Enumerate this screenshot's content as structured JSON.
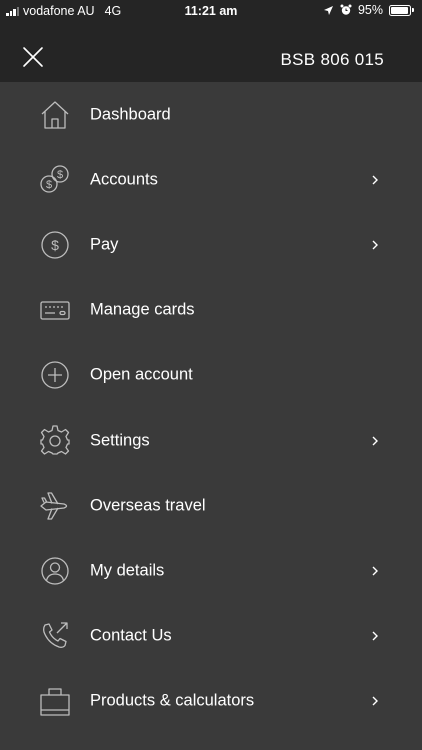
{
  "status_bar": {
    "carrier": "vodafone AU",
    "network": "4G",
    "time": "11:21 am",
    "battery": "95%",
    "battery_level": 0.95
  },
  "header": {
    "bsb": "BSB 806 015"
  },
  "menu": {
    "items": [
      {
        "label": "Dashboard",
        "icon": "home-icon",
        "has_chevron": false
      },
      {
        "label": "Accounts",
        "icon": "coins-icon",
        "has_chevron": true
      },
      {
        "label": "Pay",
        "icon": "dollar-circle-icon",
        "has_chevron": true
      },
      {
        "label": "Manage cards",
        "icon": "card-icon",
        "has_chevron": false
      },
      {
        "label": "Open account",
        "icon": "plus-circle-icon",
        "has_chevron": false
      },
      {
        "label": "Settings",
        "icon": "gear-icon",
        "has_chevron": true
      },
      {
        "label": "Overseas travel",
        "icon": "plane-icon",
        "has_chevron": false
      },
      {
        "label": "My details",
        "icon": "user-circle-icon",
        "has_chevron": true
      },
      {
        "label": "Contact Us",
        "icon": "phone-icon",
        "has_chevron": true
      },
      {
        "label": "Products & calculators",
        "icon": "bag-icon",
        "has_chevron": true
      }
    ]
  },
  "colors": {
    "background": "#3a3a3a",
    "header": "#252525",
    "icon_stroke": "#bdbdbd",
    "text": "#ffffff"
  }
}
